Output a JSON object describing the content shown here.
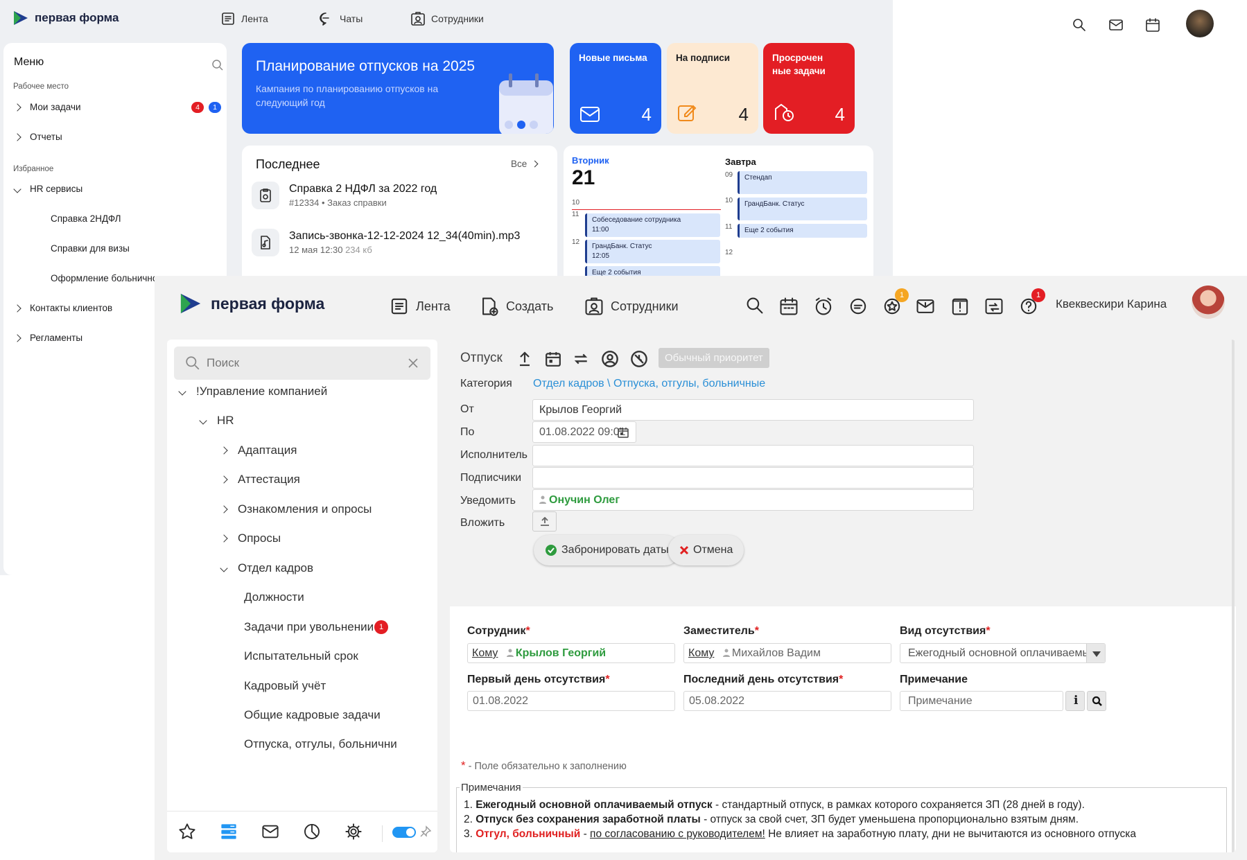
{
  "back": {
    "logo": "первая форма",
    "nav": [
      {
        "label": "Лента"
      },
      {
        "label": "Чаты"
      },
      {
        "label": "Сотрудники"
      }
    ],
    "menu": {
      "title": "Меню",
      "workplace_label": "Рабочее место",
      "my_tasks": "Мои задачи",
      "my_tasks_red": "4",
      "my_tasks_blue": "1",
      "reports": "Отчеты",
      "favorites_label": "Избранное",
      "hr_services": "HR сервисы",
      "hr_items": [
        "Справка 2НДФЛ",
        "Справки для визы",
        "Оформление больничного"
      ],
      "client_contacts": "Контакты клиентов",
      "regulations": "Регламенты"
    },
    "banner": {
      "title": "Планирование отпусков на 2025",
      "subtitle": "Кампания по планированию отпусков на следующий год"
    },
    "tiles": [
      {
        "title": "Новые письма",
        "count": "4",
        "color": "#1f62f2"
      },
      {
        "title": "На подписи",
        "count": "4",
        "color": "#fde9d2"
      },
      {
        "title": "Просрочен ные задачи",
        "count": "4",
        "color": "#e31e24"
      }
    ],
    "recent": {
      "title": "Последнее",
      "all": "Все",
      "items": [
        {
          "name": "Справка 2 НДФЛ за 2022 год",
          "sub1": "#12334",
          "sub2": "• Заказ справки"
        },
        {
          "name": "Запись-звонка-12-12-2024 12_34(40min).mp3",
          "sub1": "12 мая 12:30",
          "sub2": "234 кб"
        }
      ]
    },
    "calendar": {
      "today_label": "Вторник",
      "today_num": "21",
      "tomorrow_label": "Завтра",
      "today_hours": [
        "10",
        "11",
        "12"
      ],
      "tomorrow_hours": [
        "09",
        "10",
        "11",
        "12"
      ],
      "today_events": [
        {
          "title": "Собеседование сотрудника",
          "time": "11:00"
        },
        {
          "title": "ГрандБанк. Статус",
          "time": "12:05"
        },
        {
          "title": "Еще 2 события",
          "time": ""
        }
      ],
      "tomorrow_events": [
        {
          "title": "Стендап"
        },
        {
          "title": "ГрандБанк. Статус"
        },
        {
          "title": "Еще 2 события"
        }
      ]
    }
  },
  "front": {
    "logo": "первая форма",
    "nav": [
      {
        "label": "Лента"
      },
      {
        "label": "Создать"
      },
      {
        "label": "Сотрудники"
      }
    ],
    "badge_star": "1",
    "badge_help": "1",
    "user_name": "Квеквескири Карина",
    "search_placeholder": "Поиск",
    "tree": {
      "root": "!Управление компанией",
      "hr": "HR",
      "groups": [
        "Адаптация",
        "Аттестация",
        "Ознакомления и опросы",
        "Опросы"
      ],
      "dept": "Отдел кадров",
      "dept_items": [
        "Должности",
        "Задачи при увольнении",
        "Испытательный срок",
        "Кадровый учёт",
        "Общие кадровые задачи",
        "Отпуска, отгулы, больнични"
      ],
      "dismissal_badge": "1"
    },
    "form": {
      "title": "Отпуск",
      "priority": "Обычный приоритет",
      "category_label": "Категория",
      "category_value": "Отдел кадров \\ Отпуска, отгулы, больничные",
      "from_label": "От",
      "from_value": "Крылов Георгий",
      "to_label": "По",
      "to_value": "01.08.2022 09:01",
      "executor_label": "Исполнитель",
      "subscribers_label": "Подписчики",
      "notify_label": "Уведомить",
      "notify_value": "Онучин Олег",
      "attach_label": "Вложить",
      "book_button": "Забронировать даты",
      "cancel_button": "Отмена",
      "employee_label": "Сотрудник",
      "deputy_label": "Заместитель",
      "absence_type_label": "Вид отсутствия",
      "to_prefix": "Кому",
      "employee_value": "Крылов Георгий",
      "deputy_value": "Михайлов Вадим",
      "absence_type_value": "Ежегодный основной оплачиваемы...",
      "first_day_label": "Первый день отсутствия",
      "last_day_label": "Последний день отсутствия",
      "note_label": "Примечание",
      "first_day_value": "01.08.2022",
      "last_day_value": "05.08.2022",
      "note_placeholder": "Примечание",
      "required_note": "- Поле обязательно к заполнению",
      "notes_title": "Примечания",
      "n1_bold": "Ежегодный основной оплачиваемый отпуск",
      "n1_rest": " - стандартный отпуск, в рамках которого сохраняется ЗП (28 дней в году).",
      "n2_bold": "Отпуск без сохранения заработной платы",
      "n2_rest": " - отпуск за свой счет, ЗП будет уменьшена пропорционально взятым дням.",
      "n3_red": "Отгул, больничный",
      "n3_dash": " - ",
      "n3_link": "по согласованию с руководителем!",
      "n3_rest": " Не влияет на заработную плату, дни не вычитаются из основного отпуска"
    }
  },
  "colors": {
    "blue": "#1f62f2",
    "red": "#e31e24",
    "green": "#2e9b3e",
    "link": "#2a8fd6",
    "toggle": "#2196f3"
  }
}
